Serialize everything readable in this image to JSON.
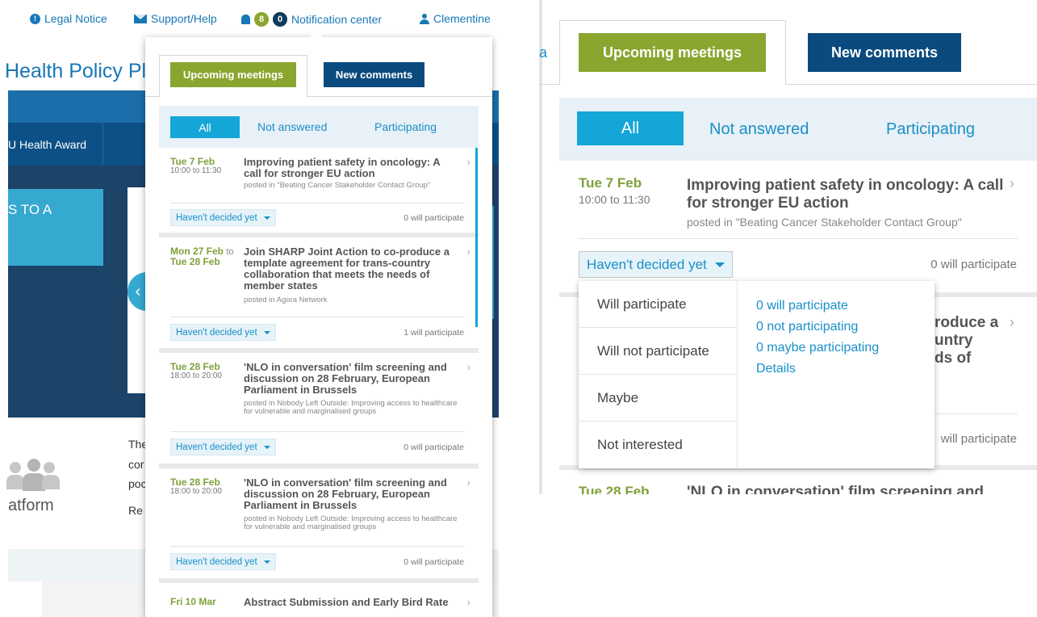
{
  "topbar": {
    "legal": "Legal Notice",
    "support": "Support/Help",
    "notif_count_green": "8",
    "notif_count_navy": "0",
    "notif_center": "Notification center",
    "user": "Clementine"
  },
  "site": {
    "title": "Health Policy Pla",
    "award": "U Health Award",
    "hero_text": "S TO A",
    "platform": "atform",
    "frag_the": "The",
    "frag_cor": "cor",
    "frag_poc": "poc",
    "frag_re": "Re"
  },
  "popup": {
    "tab_upcoming": "Upcoming meetings",
    "tab_comments": "New comments",
    "filter_all": "All",
    "filter_not_answered": "Not answered",
    "filter_participating": "Participating",
    "items": [
      {
        "date": "Tue 7 Feb",
        "time": "10:00 to 11:30",
        "title": "Improving patient safety in oncology: A call for stronger EU action",
        "posted": "posted in \"Beating Cancer Stakeholder Contact Group\"",
        "status": "Haven't decided yet",
        "participants": "0 will participate"
      },
      {
        "date": "Mon 27 Feb",
        "date_to": "to",
        "date2": "Tue 28 Feb",
        "title": "Join SHARP Joint Action to co-produce a template agreement for trans-country collaboration that meets the needs of member states",
        "posted": "posted in Agora Network",
        "status": "Haven't decided yet",
        "participants": "1 will participate"
      },
      {
        "date": "Tue 28 Feb",
        "time": "18:00 to 20:00",
        "title": "'NLO in conversation' film screening and discussion on 28 February, European Parliament in Brussels",
        "posted": "posted in Nobody Left Outside: Improving access to healthcare for vulnerable and marginalised groups",
        "status": "Haven't decided yet",
        "participants": "0 will participate"
      },
      {
        "date": "Tue 28 Feb",
        "time": "18:00 to 20:00",
        "title": "'NLO in conversation' film screening and discussion on 28 February, European Parliament in Brussels",
        "posted": "posted in Nobody Left Outside: Improving access to healthcare for vulnerable and marginalised groups",
        "status": "Haven't decided yet",
        "participants": "0 will participate"
      },
      {
        "date": "Fri 10 Mar",
        "title": "Abstract Submission and Early Bird Rate"
      }
    ]
  },
  "zoom": {
    "tab_upcoming": "Upcoming meetings",
    "tab_comments": "New comments",
    "filter_all": "All",
    "filter_not_answered": "Not answered",
    "filter_participating": "Participating",
    "item": {
      "date": "Tue 7 Feb",
      "time": "10:00 to 11:30",
      "title": "Improving patient safety in oncology: A call for stronger EU action",
      "posted": "posted in \"Beating Cancer Stakeholder Contact Group\"",
      "status": "Haven't decided yet",
      "participants": "0 will participate"
    },
    "behind": {
      "line1": "roduce a",
      "line2": "untry",
      "line3": "ds of",
      "participants": "will participate",
      "next_date": "Tue 28 Feb",
      "next_title": "'NLO in conversation' film screening and"
    },
    "dropdown": {
      "options": [
        "Will participate",
        "Will not participate",
        "Maybe",
        "Not interested"
      ],
      "stats": [
        "0 will participate",
        "0 not participating",
        "0 maybe participating"
      ],
      "details": "Details"
    }
  }
}
